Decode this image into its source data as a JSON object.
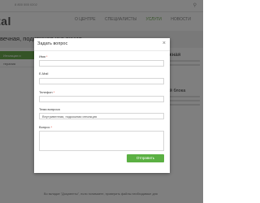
{
  "page": {
    "phone": "8 800 555 0202",
    "logo": "tal",
    "menu": [
      "О ЦЕНТРЕ",
      "СПЕЦИАЛИСТЫ",
      "УСЛУГИ",
      "НОВОСТИ"
    ],
    "heading": "вечная, подкожная инъекция",
    "breadcrumbs": "Главная · Услуги · Инъекционная косметология",
    "sidebar": [
      "Инъекции и мезотерапия",
      "терапия"
    ],
    "right_heading": "подкожная",
    "right_subheading": "рфтовой блока",
    "bottom_text": "Во вкладке \"Документы\", если понимаете, проверить файлы необходимые для"
  },
  "modal": {
    "title": "Задать вопрос",
    "close_label": "×",
    "fields": {
      "name": {
        "label": "Имя",
        "required": true,
        "value": ""
      },
      "email": {
        "label": "E-Mail",
        "required": false,
        "value": ""
      },
      "phone": {
        "label": "Телефон",
        "required": true,
        "value": ""
      },
      "topic": {
        "label": "Тема вопроса",
        "required": false,
        "value": "Внутривенная, подкожная инъекция"
      },
      "question": {
        "label": "Вопрос",
        "required": true,
        "value": ""
      }
    },
    "submit_label": "Отправить",
    "required_mark": "*"
  },
  "colors": {
    "accent": "#5bb043",
    "required": "#e74c3c"
  },
  "icons": {
    "search": "search-icon",
    "close": "close-icon"
  }
}
